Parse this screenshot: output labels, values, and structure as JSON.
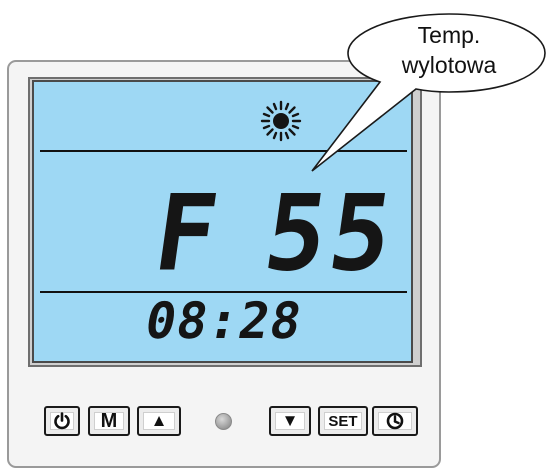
{
  "display": {
    "mode_letter": "F",
    "temperature": "55",
    "clock": "08:28",
    "status_icon": "sun-icon"
  },
  "callout": {
    "line1": "Temp.",
    "line2": "wylotowa"
  },
  "buttons": {
    "power": "power-icon",
    "mode": "M",
    "up": "▲",
    "down": "▼",
    "set": "SET",
    "timer": "clock-icon"
  },
  "colors": {
    "lcd_background": "#9ed8f4",
    "segment": "#151515",
    "device_body": "#f4f4f4"
  }
}
